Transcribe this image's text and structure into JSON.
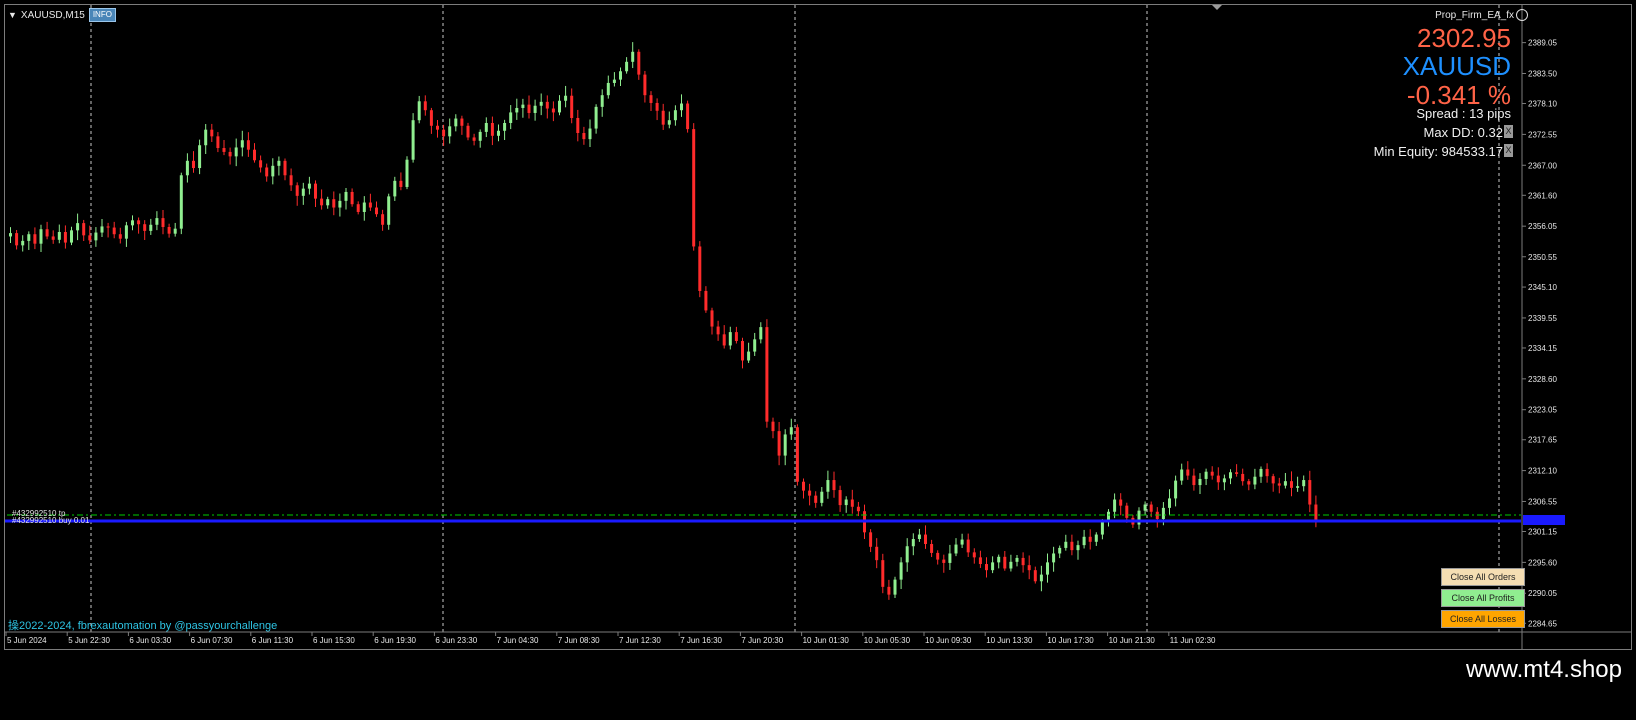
{
  "chart_header": {
    "symbol_timeframe": "XAUUSD,M15",
    "info_button": "INFO"
  },
  "ea_panel": {
    "ea_name": "Prop_Firm_EA_fx",
    "current_price": "2302.95",
    "symbol": "XAUUSD",
    "change_pct": "-0.341 %",
    "spread": "Spread : 13 pips",
    "max_dd": "Max DD: 0.32",
    "min_equity": "Min Equity: 984533.17",
    "close_box": "X"
  },
  "order_lines": {
    "tp_label": "#432992510 tp",
    "buy_label": "#432992510 buy 0.01"
  },
  "copyright": "操2022-2024, fbrexautomation by @passyourchallenge",
  "buttons": {
    "close_all_orders": "Close All Orders",
    "close_all_profits": "Close All Profits",
    "close_all_losses": "Close All Losses"
  },
  "watermark": "www.mt4.shop",
  "colors": {
    "background": "#000000",
    "bull_candle": "#90ee90",
    "bear_candle": "#ff2b2b",
    "grid": "#c8c8c8",
    "ask_line": "#1a1aff",
    "tp_line": "#00cc00",
    "price_text": "#ff6347",
    "symbol_text": "#1e90ff"
  },
  "chart_data": {
    "type": "candlestick",
    "symbol": "XAUUSD",
    "timeframe": "M15",
    "y_ticks": [
      "2389.05",
      "2383.50",
      "2378.10",
      "2372.55",
      "2367.00",
      "2361.60",
      "2356.05",
      "2350.55",
      "2345.10",
      "2339.55",
      "2334.15",
      "2328.60",
      "2323.05",
      "2317.65",
      "2312.10",
      "2306.55",
      "2301.15",
      "2295.60",
      "2290.05",
      "2284.65"
    ],
    "ylim": [
      2283.8,
      2391.5
    ],
    "x_ticks": [
      "5 Jun 2024",
      "5 Jun 22:30",
      "6 Jun 03:30",
      "6 Jun 07:30",
      "6 Jun 11:30",
      "6 Jun 15:30",
      "6 Jun 19:30",
      "6 Jun 23:30",
      "7 Jun 04:30",
      "7 Jun 08:30",
      "7 Jun 12:30",
      "7 Jun 16:30",
      "7 Jun 20:30",
      "10 Jun 01:30",
      "10 Jun 05:30",
      "10 Jun 09:30",
      "10 Jun 13:30",
      "10 Jun 17:30",
      "10 Jun 21:30",
      "11 Jun 02:30"
    ],
    "period_separators": [
      "6 Jun",
      "7 Jun",
      "10 Jun",
      "11 Jun",
      "12 Jun"
    ],
    "closes": [
      2354.8,
      2352.6,
      2353.4,
      2354.6,
      2352.9,
      2355.5,
      2354.2,
      2353.6,
      2355.0,
      2353.1,
      2355.3,
      2356.6,
      2354.4,
      2353.5,
      2354.9,
      2356.0,
      2355.8,
      2354.6,
      2353.8,
      2356.2,
      2357.1,
      2356.4,
      2355.2,
      2356.3,
      2357.5,
      2355.9,
      2354.7,
      2355.6,
      2365.2,
      2367.8,
      2366.5,
      2370.6,
      2373.4,
      2372.2,
      2370.1,
      2369.4,
      2368.6,
      2370.2,
      2371.5,
      2369.8,
      2367.9,
      2366.6,
      2365.0,
      2366.9,
      2367.8,
      2365.2,
      2363.4,
      2361.5,
      2362.8,
      2363.7,
      2361.0,
      2359.8,
      2360.9,
      2359.4,
      2360.6,
      2362.2,
      2360.0,
      2358.6,
      2360.3,
      2359.4,
      2358.2,
      2356.3,
      2361.4,
      2364.2,
      2363.1,
      2368.0,
      2375.1,
      2378.5,
      2376.9,
      2374.1,
      2373.4,
      2372.2,
      2374.0,
      2375.4,
      2374.1,
      2372.0,
      2371.4,
      2373.0,
      2374.6,
      2372.3,
      2373.2,
      2374.6,
      2376.5,
      2377.3,
      2377.9,
      2376.4,
      2377.7,
      2378.4,
      2377.2,
      2376.5,
      2378.6,
      2379.5,
      2375.5,
      2372.8,
      2371.7,
      2373.6,
      2377.5,
      2379.6,
      2381.8,
      2382.4,
      2383.9,
      2385.6,
      2387.4,
      2383.3,
      2379.6,
      2378.2,
      2376.8,
      2374.3,
      2375.1,
      2376.9,
      2378.1,
      2373.5,
      2352.4,
      2344.4,
      2340.9,
      2338.0,
      2336.6,
      2334.6,
      2337.0,
      2335.4,
      2331.9,
      2333.5,
      2335.7,
      2337.9,
      2320.9,
      2319.2,
      2314.8,
      2318.6,
      2319.9,
      2310.1,
      2308.5,
      2307.6,
      2306.3,
      2308.3,
      2310.4,
      2308.6,
      2305.9,
      2306.9,
      2305.6,
      2304.8,
      2301.0,
      2298.4,
      2296.0,
      2291.2,
      2289.8,
      2292.5,
      2295.6,
      2298.5,
      2299.8,
      2300.6,
      2298.9,
      2297.3,
      2296.1,
      2295.5,
      2297.2,
      2298.8,
      2299.7,
      2297.4,
      2296.5,
      2295.3,
      2294.2,
      2295.6,
      2296.6,
      2294.5,
      2295.7,
      2296.4,
      2295.1,
      2294.2,
      2292.2,
      2293.4,
      2295.6,
      2297.2,
      2298.2,
      2299.3,
      2297.8,
      2298.7,
      2300.2,
      2299.3,
      2300.6,
      2302.8,
      2304.7,
      2306.9,
      2305.8,
      2303.6,
      2302.4,
      2304.9,
      2306.0,
      2304.7,
      2303.4,
      2305.4,
      2307.1,
      2310.3,
      2312.3,
      2311.2,
      2309.5,
      2310.6,
      2311.9,
      2311.2,
      2310.0,
      2310.7,
      2311.8,
      2311.5,
      2310.2,
      2309.6,
      2311.0,
      2312.4,
      2311.1,
      2309.8,
      2309.4,
      2310.2,
      2309.0,
      2309.3,
      2310.4,
      2306.0,
      2302.9
    ]
  }
}
